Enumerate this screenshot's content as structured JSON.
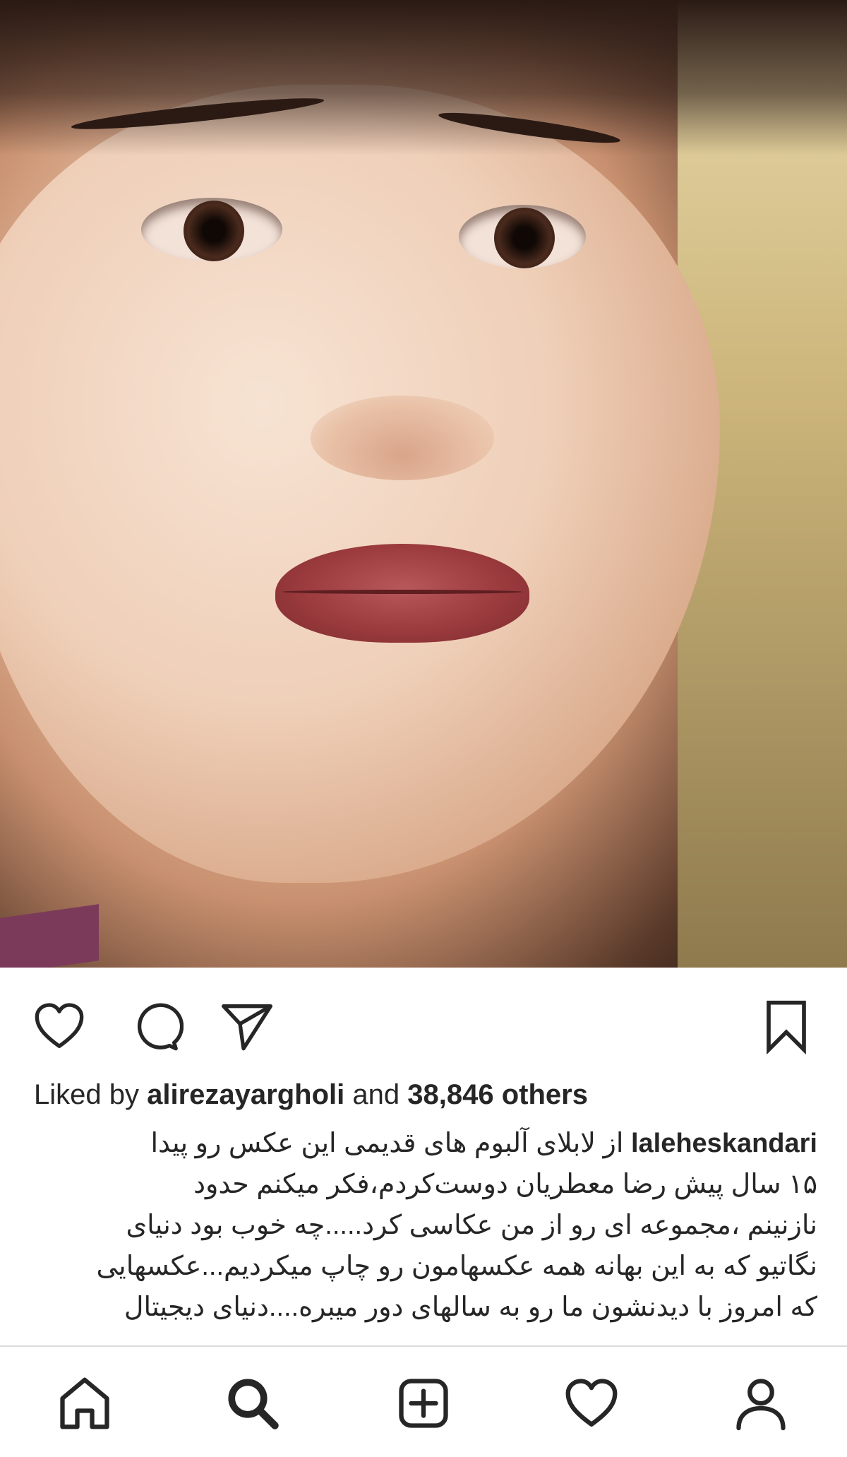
{
  "post": {
    "image_alt": "portrait photo",
    "likes": {
      "prefix": "Liked by",
      "liker": "alirezayargholi",
      "middle": "and",
      "others": "38,846 others"
    },
    "caption": {
      "username": "laleheskandari",
      "first_line": "از لابلای آلبوم های قدیمی این عکس رو پیدا",
      "lines": [
        "۱۵ سال پیش رضا معطریان دوست‌کردم،فکر میکنم حدود",
        "نازنینم ،مجموعه ای رو از من عکاسی کرد.....چه خوب بود دنیای",
        "نگاتیو که به این بهانه همه عکسهامون رو چاپ میکردیم...عکسهایی",
        "که امروز با دیدنشون ما رو به سالهای دور میبره....دنیای دیجیتال"
      ]
    }
  },
  "actions": {
    "like_icon": "heart-outline",
    "comment_icon": "speech-bubble",
    "share_icon": "paper-plane",
    "save_icon": "bookmark"
  },
  "bottom_nav": {
    "items": [
      "home",
      "search",
      "new-post",
      "activity",
      "profile"
    ]
  },
  "colors": {
    "text": "#262626",
    "divider": "#dbdbdb",
    "background": "#ffffff"
  }
}
